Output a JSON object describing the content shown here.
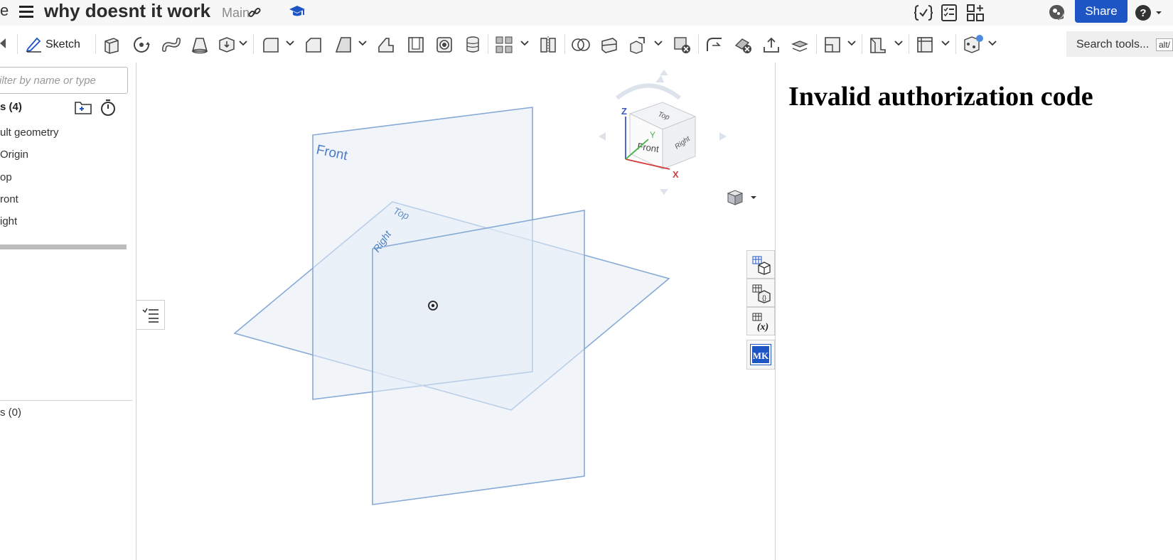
{
  "header": {
    "cut_text": "e",
    "doc_title": "why doesnt it work",
    "branch": "Main",
    "share_label": "Share"
  },
  "toolbar": {
    "sketch_label": "Sketch",
    "search_placeholder": "Search tools...",
    "search_shortcut": "alt/"
  },
  "feature_tree": {
    "filter_placeholder": "ilter by name or type",
    "features_header": "s (4)",
    "items": [
      "ult geometry",
      "Origin",
      "op",
      "ront",
      "ight"
    ],
    "parts_header": "s (0)"
  },
  "viewport": {
    "plane_labels": {
      "front": "Front",
      "top": "Top",
      "right": "Right"
    },
    "cube_faces": {
      "front": "Front",
      "top": "Top",
      "right": "Right"
    },
    "axis_labels": {
      "x": "X",
      "y": "Y",
      "z": "Z"
    },
    "plane_color": "#6a9bd1",
    "plane_fill": "#e6edf6"
  },
  "right_strip": {
    "mk_label": "MK"
  },
  "error_panel": {
    "message": "Invalid authorization code"
  },
  "colors": {
    "accent": "#1d55c4"
  }
}
